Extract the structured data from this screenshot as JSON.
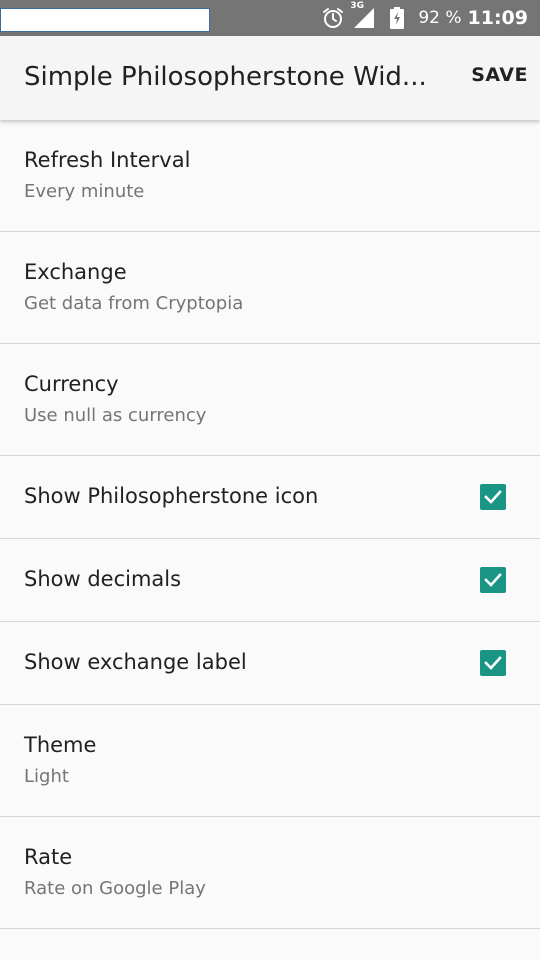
{
  "status_bar": {
    "network_type": "3G",
    "battery_percent": "92 %",
    "time": "11:09",
    "icons": [
      "alarm-icon",
      "signal-icon",
      "battery-charging-icon"
    ]
  },
  "app_bar": {
    "title": "Simple Philosopherstone Wid...",
    "save_label": "SAVE"
  },
  "preferences": [
    {
      "title": "Refresh Interval",
      "summary": "Every minute"
    },
    {
      "title": "Exchange",
      "summary": "Get data from Cryptopia"
    },
    {
      "title": "Currency",
      "summary": "Use null as currency"
    },
    {
      "title": "Show Philosopherstone icon",
      "checked": true
    },
    {
      "title": "Show decimals",
      "checked": true
    },
    {
      "title": "Show exchange label",
      "checked": true
    },
    {
      "title": "Theme",
      "summary": "Light"
    },
    {
      "title": "Rate",
      "summary": "Rate on Google Play"
    }
  ],
  "colors": {
    "status_bar_bg": "#757575",
    "checkbox_accent": "#1a9484",
    "app_bar_bg": "#f5f5f5"
  }
}
